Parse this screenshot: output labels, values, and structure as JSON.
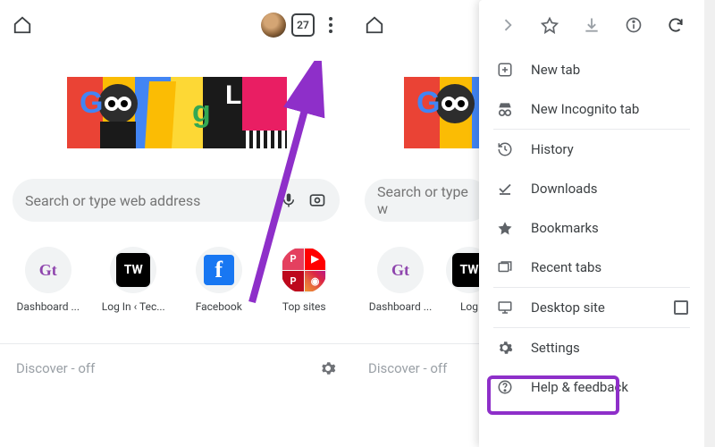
{
  "left": {
    "tabCount": "27",
    "searchPlaceholder": "Search or type web address",
    "shortcuts": [
      {
        "label": "Dashboard ...",
        "icon": "gt"
      },
      {
        "label": "Log In ‹ Tec...",
        "icon": "tw"
      },
      {
        "label": "Facebook",
        "icon": "fb"
      },
      {
        "label": "Top sites",
        "icon": "topsites"
      }
    ],
    "discover": "Discover - off"
  },
  "right": {
    "searchPlaceholder": "Search or type w",
    "shortcuts": [
      {
        "label": "Dashboard ...",
        "icon": "gt"
      },
      {
        "label": "Log",
        "icon": "tw"
      }
    ],
    "discover": "Discover - off",
    "menu": {
      "newTab": "New tab",
      "incognito": "New Incognito tab",
      "history": "History",
      "downloads": "Downloads",
      "bookmarks": "Bookmarks",
      "recentTabs": "Recent tabs",
      "desktopSite": "Desktop site",
      "settings": "Settings",
      "helpFeedback": "Help & feedback"
    }
  }
}
